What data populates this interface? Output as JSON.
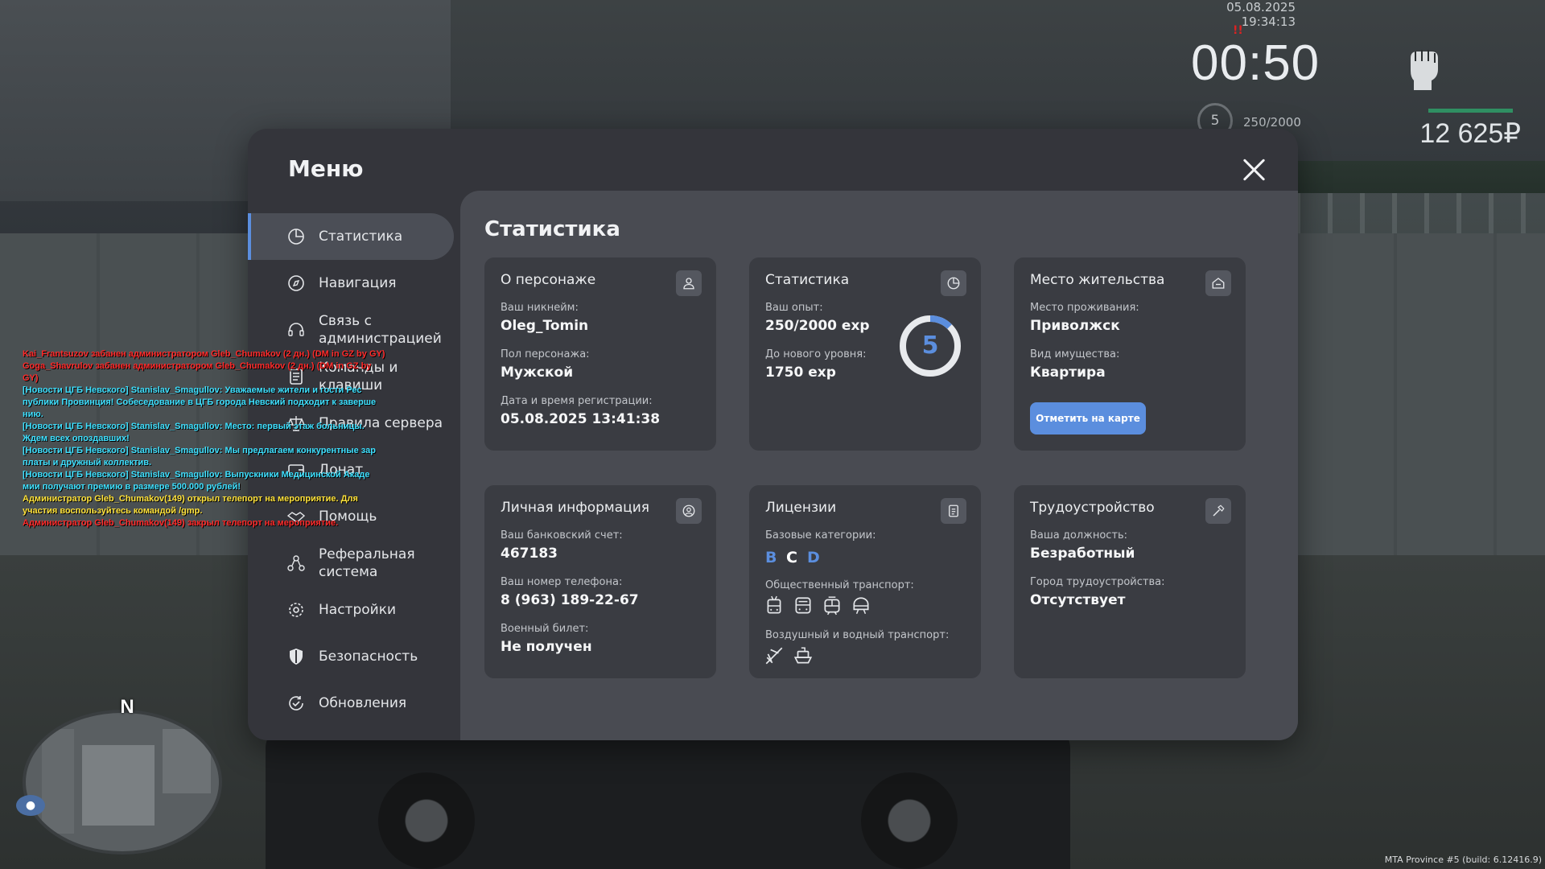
{
  "hud": {
    "datetime": "05.08.2025 19:34:13",
    "timer": "00:50",
    "timer_mark": "!!",
    "level": "5",
    "exp": "250/2000",
    "money": "12 625₽",
    "build": "MTA Province #5 (build: 6.12416.9)",
    "compass": "N"
  },
  "chat": [
    {
      "text": "Kai_Frantsuzov забанен администратором Gleb_Chumakov (2 дн.) (DM in GZ by GY)",
      "color": "#ff2a2a"
    },
    {
      "text": "Goga_Shavrulov забанен администратором Gleb_Chumakov (2 дн.) (DM in GZ by",
      "color": "#ff2a2a"
    },
    {
      "text": " GY)",
      "color": "#ff2a2a"
    },
    {
      "text": "[Новости ЦГБ Невского] Stanislav_Smagullov: Уважаемые жители и гости Рес",
      "color": "#3ee0ff"
    },
    {
      "text": "публики Провинция! Собеседование в ЦГБ города Невский подходит к заверше",
      "color": "#3ee0ff"
    },
    {
      "text": "нию.",
      "color": "#3ee0ff"
    },
    {
      "text": "[Новости ЦГБ Невского] Stanislav_Smagullov: Место: первый этаж больницы.",
      "color": "#3ee0ff"
    },
    {
      "text": " Ждем всех опоздавших!",
      "color": "#3ee0ff"
    },
    {
      "text": "[Новости ЦГБ Невского] Stanislav_Smagullov: Мы предлагаем конкурентные зар",
      "color": "#3ee0ff"
    },
    {
      "text": "платы и дружный коллектив.",
      "color": "#3ee0ff"
    },
    {
      "text": "[Новости ЦГБ Невского] Stanislav_Smagullov: Выпускники Медицинской Акаде",
      "color": "#3ee0ff"
    },
    {
      "text": "мии получают премию в размере 500.000 рублей!",
      "color": "#3ee0ff"
    },
    {
      "text": "Администратор Gleb_Chumakov(149) открыл телепорт на мероприятие. Для",
      "color": "#ffe23a"
    },
    {
      "text": " участия воспользуйтесь командой /gmp.",
      "color": "#ffe23a"
    },
    {
      "text": "Администратор Gleb_Chumakov(149) закрыл телепорт на мероприятие.",
      "color": "#ff2a2a"
    }
  ],
  "menu": {
    "title": "Меню",
    "sidebar": [
      {
        "label": "Статистика",
        "icon": "pie-chart-icon"
      },
      {
        "label": "Навигация",
        "icon": "compass-icon"
      },
      {
        "label": "Связь с администрацией",
        "icon": "headset-icon"
      },
      {
        "label": "Команды и клавиши",
        "icon": "document-icon"
      },
      {
        "label": "Правила сервера",
        "icon": "scales-icon"
      },
      {
        "label": "Донат",
        "icon": "wallet-icon"
      },
      {
        "label": "Помощь",
        "icon": "handshake-icon"
      },
      {
        "label": "Реферальная система",
        "icon": "network-icon"
      },
      {
        "label": "Настройки",
        "icon": "gear-icon"
      },
      {
        "label": "Безопасность",
        "icon": "shield-icon"
      },
      {
        "label": "Обновления",
        "icon": "refresh-check-icon"
      }
    ],
    "content_title": "Статистика",
    "cards": {
      "character": {
        "title": "О персонаже",
        "icon": "user-icon",
        "nickname_label": "Ваш никнейм:",
        "nickname": "Oleg_Tomin",
        "gender_label": "Пол персонажа:",
        "gender": "Мужской",
        "reg_label": "Дата и время регистрации:",
        "reg": "05.08.2025 13:41:38"
      },
      "stats": {
        "title": "Статистика",
        "icon": "pie-chart-icon",
        "exp_label": "Ваш опыт:",
        "exp": "250/2000 exp",
        "next_label": "До нового уровня:",
        "next": "1750 exp",
        "level": "5",
        "level_progress": 0.125,
        "accent": "#5b8ede"
      },
      "residence": {
        "title": "Место жительства",
        "icon": "house-icon",
        "place_label": "Место проживания:",
        "place": "Приволжск",
        "property_label": "Вид имущества:",
        "property": "Квартира",
        "button": "Отметить на карте"
      },
      "personal": {
        "title": "Личная информация",
        "icon": "user-circle-icon",
        "bank_label": "Ваш банковский счет:",
        "bank": "467183",
        "phone_label": "Ваш номер телефона:",
        "phone": "8 (963) 189-22-67",
        "military_label": "Военный билет:",
        "military": "Не получен"
      },
      "licenses": {
        "title": "Лицензии",
        "icon": "id-card-icon",
        "base_label": "Базовые категории:",
        "categories": [
          {
            "letter": "B",
            "owned": false
          },
          {
            "letter": "C",
            "owned": true
          },
          {
            "letter": "D",
            "owned": false
          }
        ],
        "public_label": "Общественный транспорт:",
        "public_icons": [
          "trolleybus-icon",
          "bus-icon",
          "tram-icon",
          "subway-icon"
        ],
        "air_label": "Воздушный и водный транспорт:",
        "air_icons": [
          "plane-icon",
          "ship-icon"
        ]
      },
      "job": {
        "title": "Трудоустройство",
        "icon": "hammer-icon",
        "position_label": "Ваша должность:",
        "position": "Безработный",
        "city_label": "Город трудоустройства:",
        "city": "Отсутствует"
      }
    }
  }
}
